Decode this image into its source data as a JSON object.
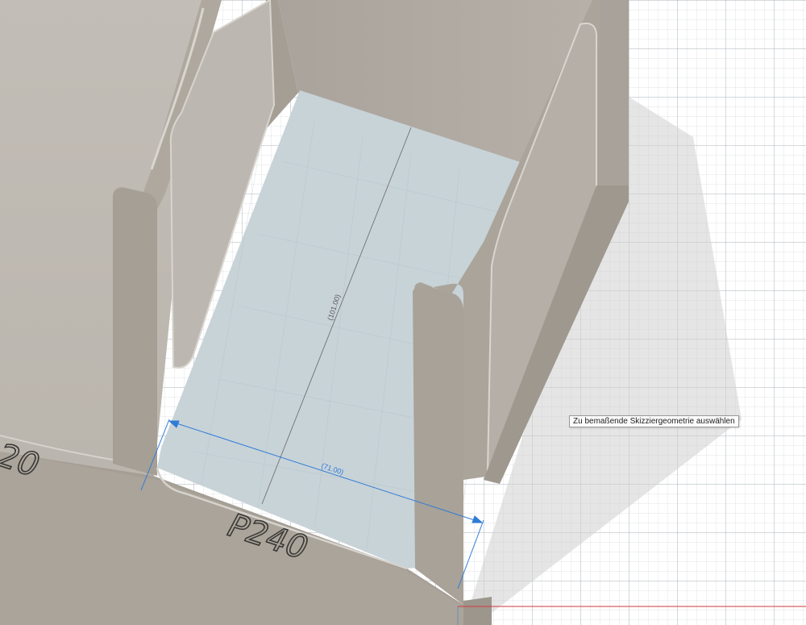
{
  "viewport": {
    "tooltip": "Zu bemaßende Skizziergeometrie auswählen",
    "dimension_width": "(71.00)",
    "dimension_depth": "(101.00)",
    "engraving_main": "P240",
    "engraving_left": "20",
    "colors": {
      "body": "#b3ada5",
      "wall_front": "#a39d94",
      "floor_selected": "#c8d3d8",
      "dimension_blue": "#2f7bd6",
      "axis_red": "#d33a3a"
    }
  }
}
